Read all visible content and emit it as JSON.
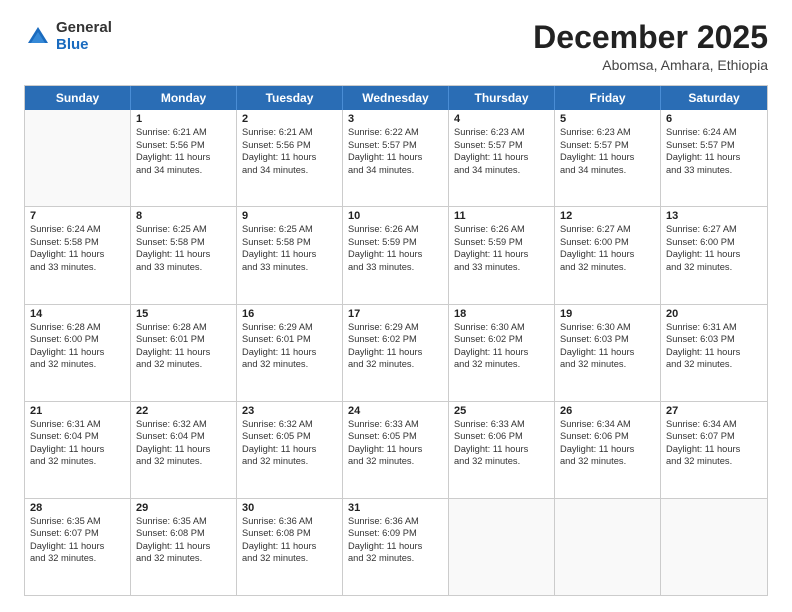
{
  "logo": {
    "general": "General",
    "blue": "Blue"
  },
  "title": "December 2025",
  "subtitle": "Abomsa, Amhara, Ethiopia",
  "header_days": [
    "Sunday",
    "Monday",
    "Tuesday",
    "Wednesday",
    "Thursday",
    "Friday",
    "Saturday"
  ],
  "weeks": [
    [
      {
        "day": "",
        "sunrise": "",
        "sunset": "",
        "daylight": ""
      },
      {
        "day": "1",
        "sunrise": "Sunrise: 6:21 AM",
        "sunset": "Sunset: 5:56 PM",
        "daylight": "Daylight: 11 hours and 34 minutes."
      },
      {
        "day": "2",
        "sunrise": "Sunrise: 6:21 AM",
        "sunset": "Sunset: 5:56 PM",
        "daylight": "Daylight: 11 hours and 34 minutes."
      },
      {
        "day": "3",
        "sunrise": "Sunrise: 6:22 AM",
        "sunset": "Sunset: 5:57 PM",
        "daylight": "Daylight: 11 hours and 34 minutes."
      },
      {
        "day": "4",
        "sunrise": "Sunrise: 6:23 AM",
        "sunset": "Sunset: 5:57 PM",
        "daylight": "Daylight: 11 hours and 34 minutes."
      },
      {
        "day": "5",
        "sunrise": "Sunrise: 6:23 AM",
        "sunset": "Sunset: 5:57 PM",
        "daylight": "Daylight: 11 hours and 34 minutes."
      },
      {
        "day": "6",
        "sunrise": "Sunrise: 6:24 AM",
        "sunset": "Sunset: 5:57 PM",
        "daylight": "Daylight: 11 hours and 33 minutes."
      }
    ],
    [
      {
        "day": "7",
        "sunrise": "Sunrise: 6:24 AM",
        "sunset": "Sunset: 5:58 PM",
        "daylight": "Daylight: 11 hours and 33 minutes."
      },
      {
        "day": "8",
        "sunrise": "Sunrise: 6:25 AM",
        "sunset": "Sunset: 5:58 PM",
        "daylight": "Daylight: 11 hours and 33 minutes."
      },
      {
        "day": "9",
        "sunrise": "Sunrise: 6:25 AM",
        "sunset": "Sunset: 5:58 PM",
        "daylight": "Daylight: 11 hours and 33 minutes."
      },
      {
        "day": "10",
        "sunrise": "Sunrise: 6:26 AM",
        "sunset": "Sunset: 5:59 PM",
        "daylight": "Daylight: 11 hours and 33 minutes."
      },
      {
        "day": "11",
        "sunrise": "Sunrise: 6:26 AM",
        "sunset": "Sunset: 5:59 PM",
        "daylight": "Daylight: 11 hours and 33 minutes."
      },
      {
        "day": "12",
        "sunrise": "Sunrise: 6:27 AM",
        "sunset": "Sunset: 6:00 PM",
        "daylight": "Daylight: 11 hours and 32 minutes."
      },
      {
        "day": "13",
        "sunrise": "Sunrise: 6:27 AM",
        "sunset": "Sunset: 6:00 PM",
        "daylight": "Daylight: 11 hours and 32 minutes."
      }
    ],
    [
      {
        "day": "14",
        "sunrise": "Sunrise: 6:28 AM",
        "sunset": "Sunset: 6:00 PM",
        "daylight": "Daylight: 11 hours and 32 minutes."
      },
      {
        "day": "15",
        "sunrise": "Sunrise: 6:28 AM",
        "sunset": "Sunset: 6:01 PM",
        "daylight": "Daylight: 11 hours and 32 minutes."
      },
      {
        "day": "16",
        "sunrise": "Sunrise: 6:29 AM",
        "sunset": "Sunset: 6:01 PM",
        "daylight": "Daylight: 11 hours and 32 minutes."
      },
      {
        "day": "17",
        "sunrise": "Sunrise: 6:29 AM",
        "sunset": "Sunset: 6:02 PM",
        "daylight": "Daylight: 11 hours and 32 minutes."
      },
      {
        "day": "18",
        "sunrise": "Sunrise: 6:30 AM",
        "sunset": "Sunset: 6:02 PM",
        "daylight": "Daylight: 11 hours and 32 minutes."
      },
      {
        "day": "19",
        "sunrise": "Sunrise: 6:30 AM",
        "sunset": "Sunset: 6:03 PM",
        "daylight": "Daylight: 11 hours and 32 minutes."
      },
      {
        "day": "20",
        "sunrise": "Sunrise: 6:31 AM",
        "sunset": "Sunset: 6:03 PM",
        "daylight": "Daylight: 11 hours and 32 minutes."
      }
    ],
    [
      {
        "day": "21",
        "sunrise": "Sunrise: 6:31 AM",
        "sunset": "Sunset: 6:04 PM",
        "daylight": "Daylight: 11 hours and 32 minutes."
      },
      {
        "day": "22",
        "sunrise": "Sunrise: 6:32 AM",
        "sunset": "Sunset: 6:04 PM",
        "daylight": "Daylight: 11 hours and 32 minutes."
      },
      {
        "day": "23",
        "sunrise": "Sunrise: 6:32 AM",
        "sunset": "Sunset: 6:05 PM",
        "daylight": "Daylight: 11 hours and 32 minutes."
      },
      {
        "day": "24",
        "sunrise": "Sunrise: 6:33 AM",
        "sunset": "Sunset: 6:05 PM",
        "daylight": "Daylight: 11 hours and 32 minutes."
      },
      {
        "day": "25",
        "sunrise": "Sunrise: 6:33 AM",
        "sunset": "Sunset: 6:06 PM",
        "daylight": "Daylight: 11 hours and 32 minutes."
      },
      {
        "day": "26",
        "sunrise": "Sunrise: 6:34 AM",
        "sunset": "Sunset: 6:06 PM",
        "daylight": "Daylight: 11 hours and 32 minutes."
      },
      {
        "day": "27",
        "sunrise": "Sunrise: 6:34 AM",
        "sunset": "Sunset: 6:07 PM",
        "daylight": "Daylight: 11 hours and 32 minutes."
      }
    ],
    [
      {
        "day": "28",
        "sunrise": "Sunrise: 6:35 AM",
        "sunset": "Sunset: 6:07 PM",
        "daylight": "Daylight: 11 hours and 32 minutes."
      },
      {
        "day": "29",
        "sunrise": "Sunrise: 6:35 AM",
        "sunset": "Sunset: 6:08 PM",
        "daylight": "Daylight: 11 hours and 32 minutes."
      },
      {
        "day": "30",
        "sunrise": "Sunrise: 6:36 AM",
        "sunset": "Sunset: 6:08 PM",
        "daylight": "Daylight: 11 hours and 32 minutes."
      },
      {
        "day": "31",
        "sunrise": "Sunrise: 6:36 AM",
        "sunset": "Sunset: 6:09 PM",
        "daylight": "Daylight: 11 hours and 32 minutes."
      },
      {
        "day": "",
        "sunrise": "",
        "sunset": "",
        "daylight": ""
      },
      {
        "day": "",
        "sunrise": "",
        "sunset": "",
        "daylight": ""
      },
      {
        "day": "",
        "sunrise": "",
        "sunset": "",
        "daylight": ""
      }
    ]
  ]
}
